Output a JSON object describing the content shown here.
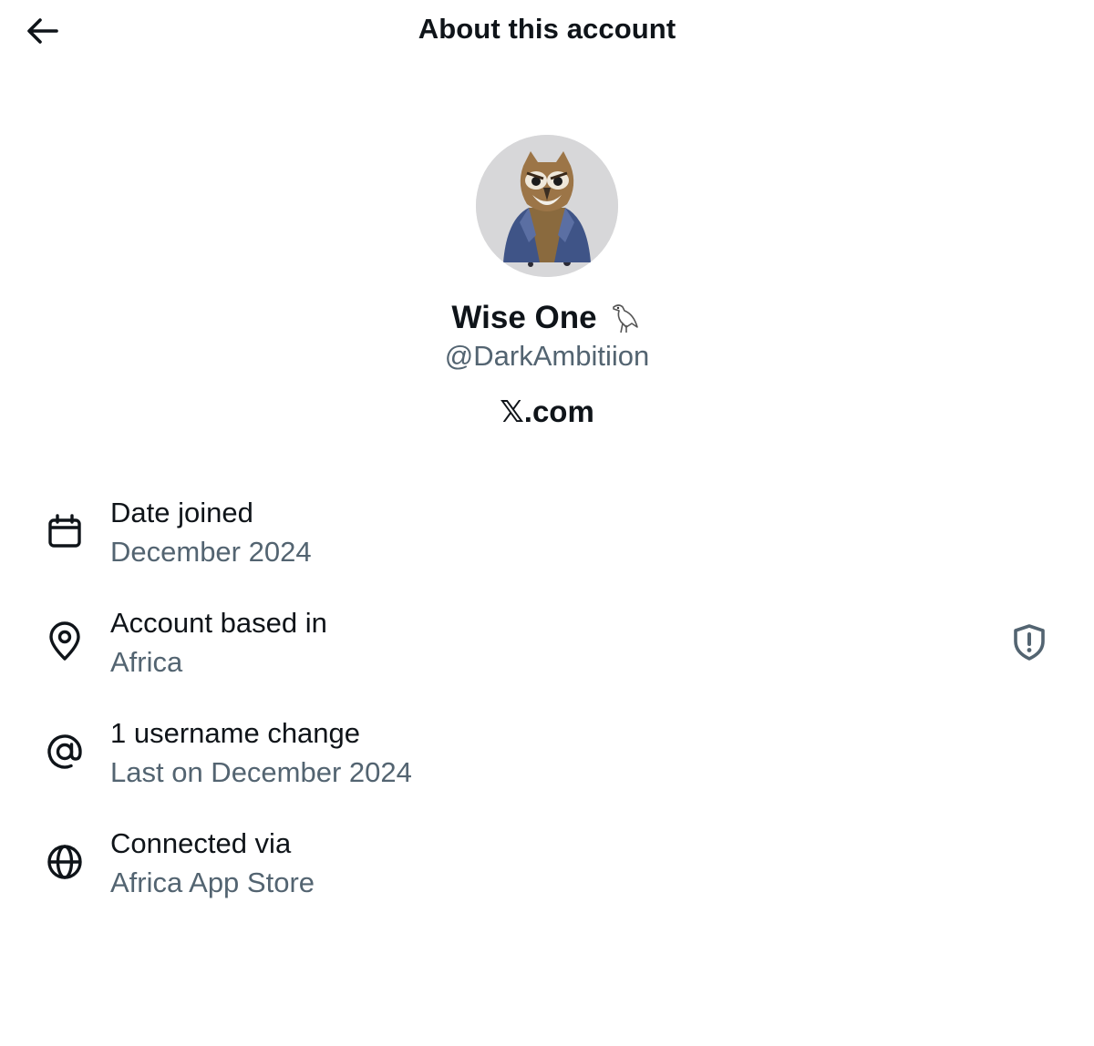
{
  "header": {
    "title": "About this account",
    "back_icon": "arrow-left-icon"
  },
  "profile": {
    "display_name": "Wise One",
    "name_emoji": "bird-emoji",
    "handle": "@DarkAmbitiion",
    "platform": "𝕏.com"
  },
  "details": [
    {
      "icon": "calendar-icon",
      "title": "Date joined",
      "value": "December 2024"
    },
    {
      "icon": "location-pin-icon",
      "title": "Account based in",
      "value": "Africa",
      "trailing_icon": "shield-alert-icon"
    },
    {
      "icon": "at-sign-icon",
      "title": "1 username change",
      "value": "Last on December 2024"
    },
    {
      "icon": "globe-icon",
      "title": "Connected via",
      "value": "Africa App Store"
    }
  ],
  "colors": {
    "text_primary": "#0f1419",
    "text_secondary": "#536471",
    "shield_icon": "#536471",
    "background": "#ffffff"
  }
}
